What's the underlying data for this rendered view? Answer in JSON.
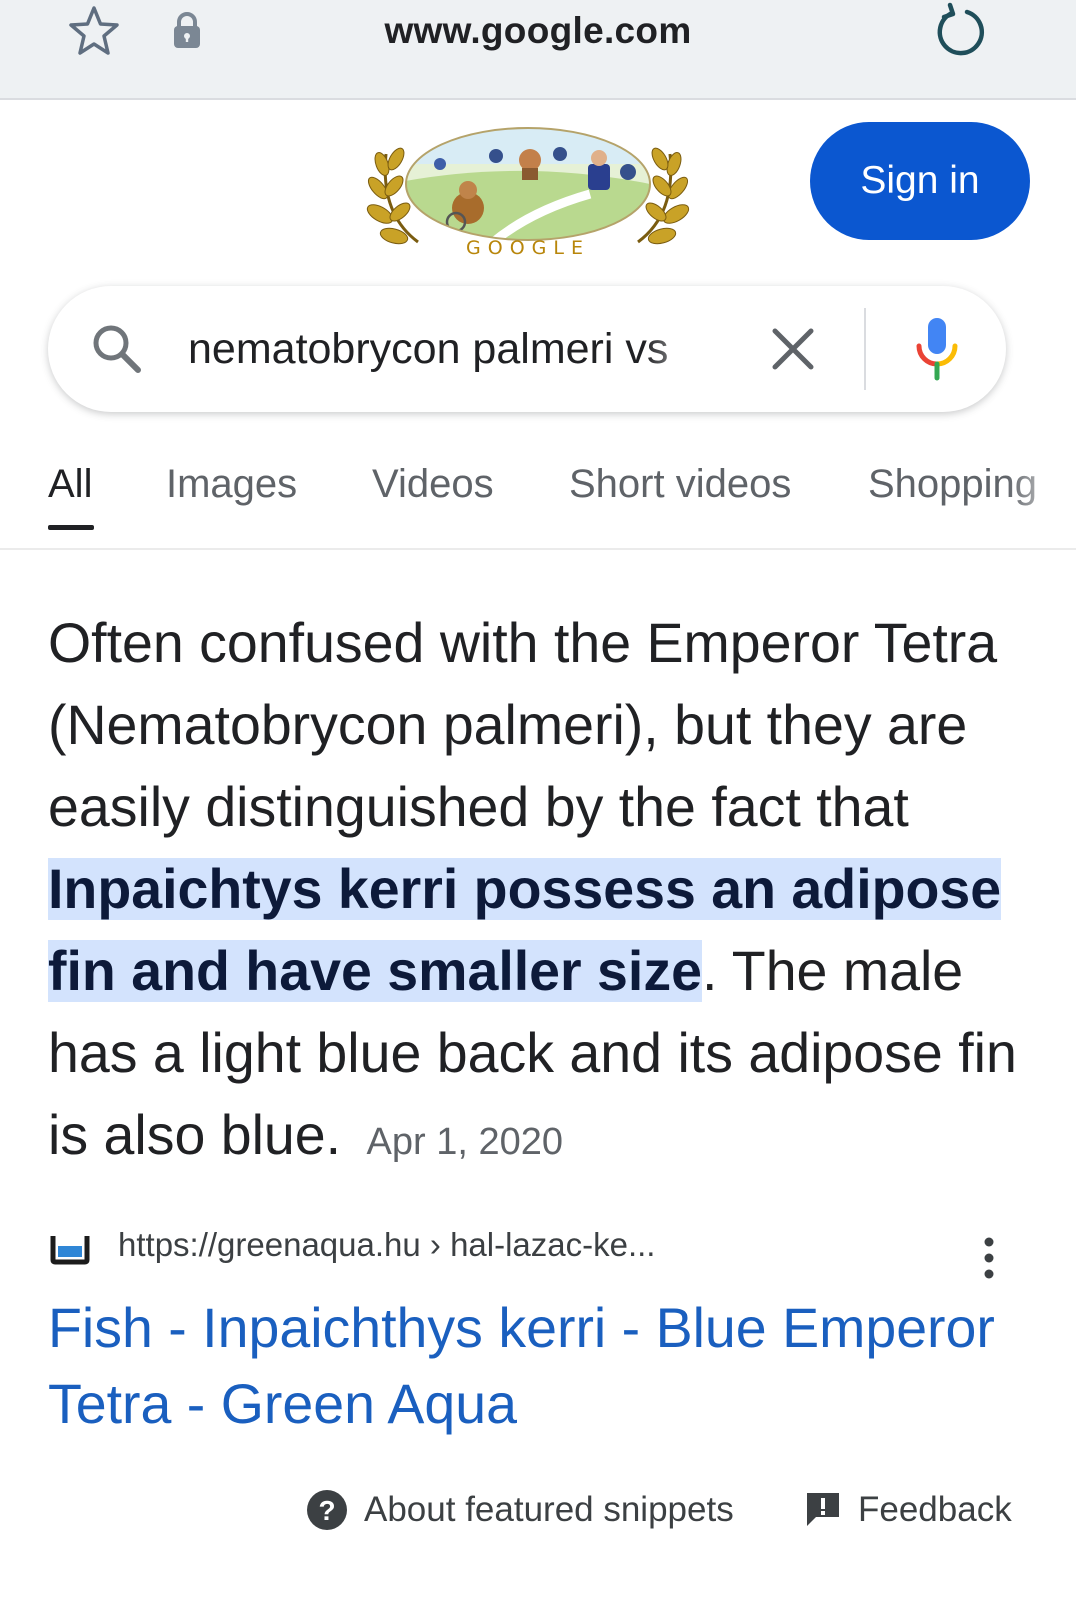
{
  "browser": {
    "url": "www.google.com"
  },
  "header": {
    "doodle_text": "GOOGLE",
    "signin_label": "Sign in"
  },
  "search": {
    "query": "nematobrycon palmeri vs"
  },
  "tabs": [
    {
      "label": "All",
      "active": true
    },
    {
      "label": "Images",
      "active": false
    },
    {
      "label": "Videos",
      "active": false
    },
    {
      "label": "Short videos",
      "active": false
    },
    {
      "label": "Shopping",
      "active": false
    }
  ],
  "snippet": {
    "text_before": "Often confused with the Emperor Tetra (Nematobrycon palmeri), but they are easily distinguished by the fact that ",
    "highlight": "Inpaichtys kerri possess an adipose fin and have smaller size",
    "text_after": ". The male has a light blue back and its adipose fin is also blue.",
    "date": "Apr 1, 2020"
  },
  "source": {
    "url": "https://greenaqua.hu › hal-lazac-ke...",
    "title": "Fish - Inpaichthys kerri - Blue Emperor Tetra - Green Aqua"
  },
  "footer": {
    "about_label": "About featured snippets",
    "feedback_label": "Feedback"
  },
  "colors": {
    "accent_blue": "#0b57d0",
    "link_blue": "#1a5fbf",
    "highlight_bg": "#d3e3fd"
  }
}
